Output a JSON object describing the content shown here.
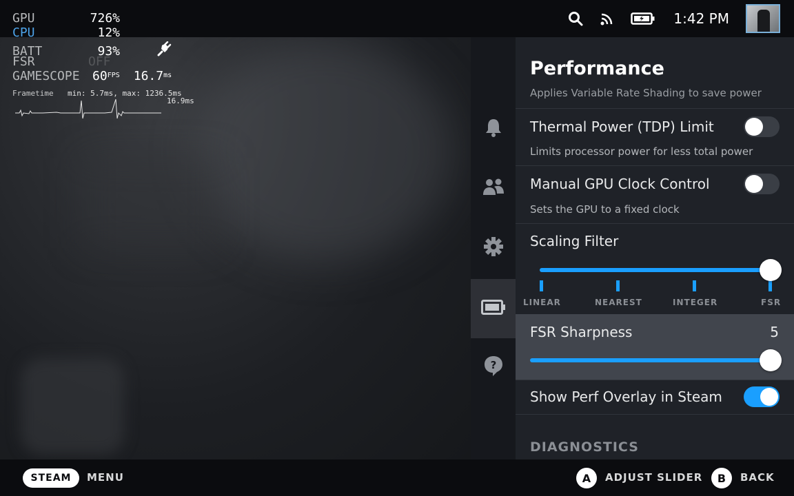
{
  "status_bar": {
    "time": "1:42 PM",
    "icons": [
      "search-icon",
      "wifi-icon",
      "battery-charging-icon"
    ]
  },
  "overlay": {
    "rows": [
      {
        "label": "GPU",
        "value": "726%"
      },
      {
        "label": "CPU",
        "value": "12%"
      },
      {
        "label": "BATT",
        "value": "93%"
      },
      {
        "label": "FSR",
        "value": "OFF"
      }
    ],
    "gamescope_label": "GAMESCOPE",
    "fps_value": "60",
    "fps_unit": "FPS",
    "ms_value": "16.7",
    "ms_unit": "ms",
    "frametime_label": "Frametime",
    "frametime_stats": "min: 5.7ms, max: 1236.5ms",
    "frametime_current": "16.9ms"
  },
  "sidenav": {
    "items": [
      {
        "icon": "bell-icon",
        "active": false
      },
      {
        "icon": "friends-icon",
        "active": false
      },
      {
        "icon": "gear-icon",
        "active": false
      },
      {
        "icon": "battery-icon",
        "active": true
      },
      {
        "icon": "help-icon",
        "active": false
      }
    ]
  },
  "panel": {
    "title": "Performance",
    "cut_description": "Applies Variable Rate Shading to save power",
    "settings": {
      "tdp": {
        "label": "Thermal Power (TDP) Limit",
        "description": "Limits processor power for less total power",
        "enabled": false
      },
      "gpu_clock": {
        "label": "Manual GPU Clock Control",
        "description": "Sets the GPU to a fixed clock",
        "enabled": false
      },
      "scaling": {
        "label": "Scaling Filter",
        "options": [
          "LINEAR",
          "NEAREST",
          "INTEGER",
          "FSR"
        ],
        "selected": "FSR"
      },
      "fsr": {
        "label": "FSR Sharpness",
        "value": "5",
        "fraction": 1.0
      },
      "overlay": {
        "label": "Show Perf Overlay in Steam",
        "enabled": true
      }
    },
    "section_header": "DIAGNOSTICS"
  },
  "bottom_bar": {
    "steam": "STEAM",
    "menu": "MENU",
    "a_key": "A",
    "a_label": "ADJUST SLIDER",
    "b_key": "B",
    "b_label": "BACK"
  },
  "colors": {
    "accent": "#1a9fff",
    "panel_bg": "#1f2228",
    "highlight_bg": "#41454d",
    "cpu_label": "#4da3e8"
  }
}
